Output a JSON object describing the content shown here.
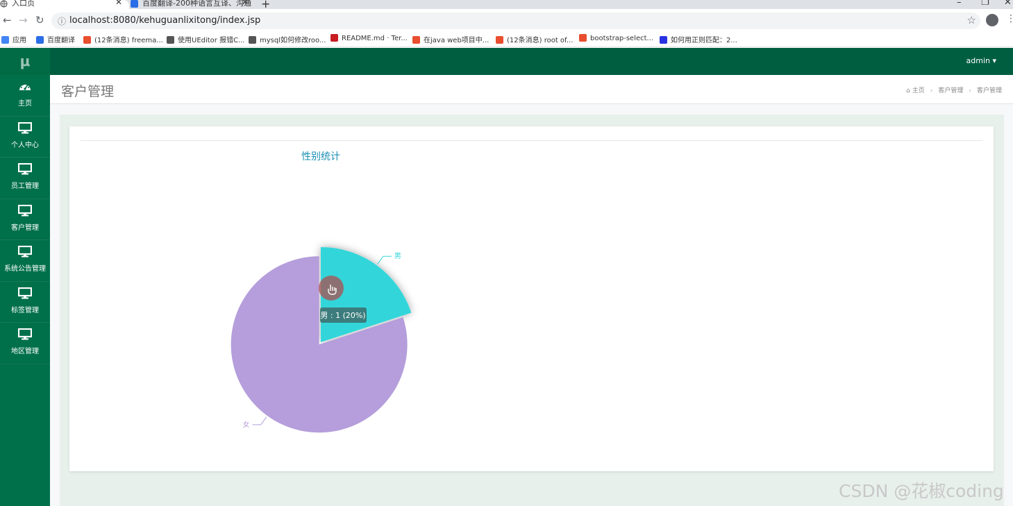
{
  "browser": {
    "tabs": [
      {
        "title": "入口页"
      },
      {
        "title": "百度翻译-200种语言互译、沟通"
      }
    ],
    "url": "localhost:8080/kehuguanlixitong/index.jsp",
    "bookmarks": [
      {
        "label": "应用",
        "color": "#4285f4"
      },
      {
        "label": "百度翻译",
        "color": "#2b6de6"
      },
      {
        "label": "(12条消息) freema...",
        "color": "#e94e2f"
      },
      {
        "label": "使用UEditor 报错C...",
        "color": "#555555"
      },
      {
        "label": "mysql如何修改roo...",
        "color": "#555555"
      },
      {
        "label": "README.md · Ter...",
        "color": "#c71d23"
      },
      {
        "label": "在java web项目中...",
        "color": "#e94e2f"
      },
      {
        "label": "(12条消息) root of...",
        "color": "#e94e2f"
      },
      {
        "label": "bootstrap-select...",
        "color": "#e94e2f"
      },
      {
        "label": "如何用正则匹配：2...",
        "color": "#2932e1"
      }
    ]
  },
  "app": {
    "logo": "μ",
    "user": "admin ▾",
    "sidebar": [
      {
        "label": "主页",
        "icon": "dashboard-icon"
      },
      {
        "label": "个人中心",
        "icon": "monitor-icon"
      },
      {
        "label": "员工管理",
        "icon": "monitor-icon"
      },
      {
        "label": "客户管理",
        "icon": "monitor-icon"
      },
      {
        "label": "系统公告管理",
        "icon": "monitor-icon"
      },
      {
        "label": "标签管理",
        "icon": "monitor-icon"
      },
      {
        "label": "地区管理",
        "icon": "monitor-icon"
      }
    ],
    "page_title": "客户管理",
    "breadcrumb": [
      "主页",
      "客户管理",
      "客户管理"
    ]
  },
  "chart_data": {
    "type": "pie",
    "title": "性别统计",
    "slices": [
      {
        "name": "男",
        "value": 1,
        "color": "#32d6da"
      },
      {
        "name": "女",
        "value": 4,
        "color": "#b59edb"
      }
    ],
    "tooltip": "男 : 1 (20%)",
    "highlighted": "男"
  },
  "watermark": "CSDN @花椒coding"
}
